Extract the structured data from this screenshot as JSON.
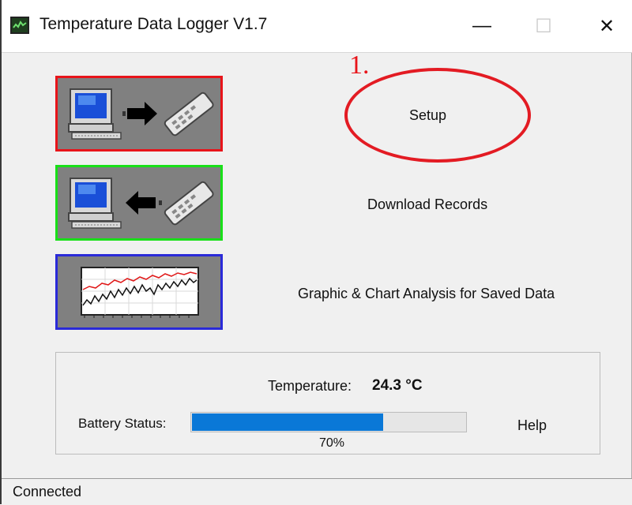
{
  "window": {
    "title": "Temperature Data Logger V1.7",
    "controls": {
      "minimize": "—",
      "maximize": "☐",
      "close": "✕"
    }
  },
  "actions": [
    {
      "label": "Setup",
      "icon": "computer-to-logger-icon",
      "border_color": "#e8141a"
    },
    {
      "label": "Download Records",
      "icon": "logger-to-computer-icon",
      "border_color": "#18e018"
    },
    {
      "label": "Graphic & Chart Analysis for Saved Data",
      "icon": "chart-analysis-icon",
      "border_color": "#2a2ad8"
    }
  ],
  "annotation": {
    "step": "1.",
    "color": "#e31b23"
  },
  "status_panel": {
    "temperature_label": "Temperature:",
    "temperature_value": "24.3 °C",
    "battery_label": "Battery Status:",
    "battery_percent": 70,
    "battery_text": "70%",
    "battery_color": "#0a78d7",
    "help_label": "Help"
  },
  "statusbar": {
    "text": "Connected"
  }
}
